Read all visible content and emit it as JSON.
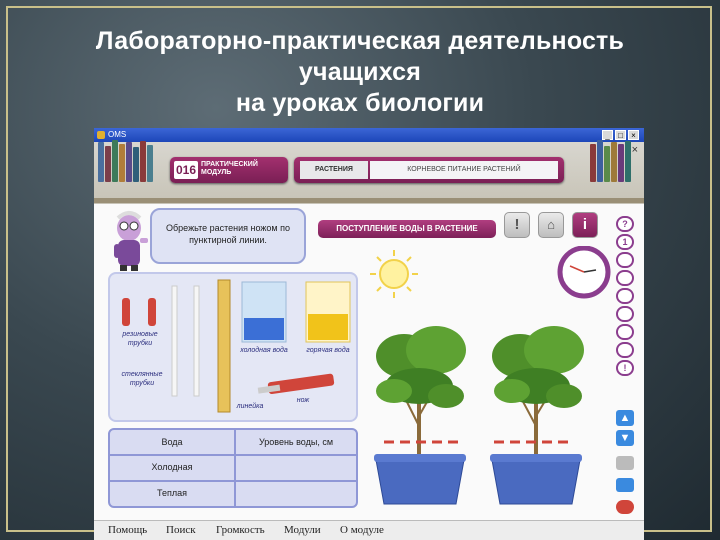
{
  "slide": {
    "title_lines": [
      "Лабораторно-практическая деятельность",
      "учащихся",
      "на уроках биологии"
    ]
  },
  "app": {
    "window_title": "OMS",
    "window_buttons": [
      "_",
      "□",
      "×"
    ],
    "inner_close": "×",
    "module": {
      "number": "016",
      "label_line1": "ПРАКТИЧЕСКИЙ",
      "label_line2": "МОДУЛЬ"
    },
    "breadcrumb": {
      "section": "РАСТЕНИЯ",
      "topic": "КОРНЕВОЕ ПИТАНИЕ РАСТЕНИЙ"
    },
    "instruction": "Обрежьте растения ножом по пунктирной линии.",
    "experiment_title": "ПОСТУПЛЕНИЕ ВОДЫ В РАСТЕНИЕ",
    "toolbar": [
      "alert-icon",
      "home-icon",
      "info-icon"
    ],
    "equipment_labels": {
      "rubber_tubes": "резиновые трубки",
      "glass_tubes": "стеклянные трубки",
      "ruler": "линейка",
      "cold_water": "холодная вода",
      "hot_water": "горячая вода",
      "knife": "нож"
    },
    "table": {
      "headers": [
        "Вода",
        "Уровень воды, см"
      ],
      "rows": [
        [
          "Холодная",
          ""
        ],
        [
          "Теплая",
          ""
        ]
      ]
    },
    "steps": [
      "?",
      "1",
      "",
      "",
      "",
      "",
      "",
      "",
      "",
      "!"
    ],
    "menu": [
      "Помощь",
      "Поиск",
      "Громкость",
      "Модули",
      "О модуле"
    ],
    "colors": {
      "accent": "#8b2a66",
      "frame": "#c9c08a",
      "panel": "#e4e7f5"
    }
  }
}
